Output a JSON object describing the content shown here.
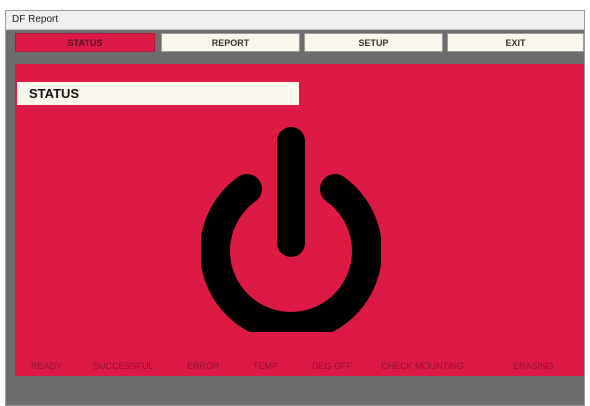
{
  "window": {
    "title": "DF Report"
  },
  "nav": {
    "status_label": "STATUS",
    "report_label": "REPORT",
    "setup_label": "SETUP",
    "exit_label": "EXIT"
  },
  "main": {
    "heading": "STATUS",
    "power_icon": "power-icon"
  },
  "status_indicators": [
    "READY",
    "SUCCESSFUL",
    "ERROR",
    "TEMP",
    "DEG OFF",
    "CHECK MOUNTING",
    "ERASING"
  ],
  "colors": {
    "accent": "#dd1a44",
    "button_bg": "#fbf7ec",
    "frame": "#6d6d6d",
    "indicator_text": "#8a0f2b"
  }
}
